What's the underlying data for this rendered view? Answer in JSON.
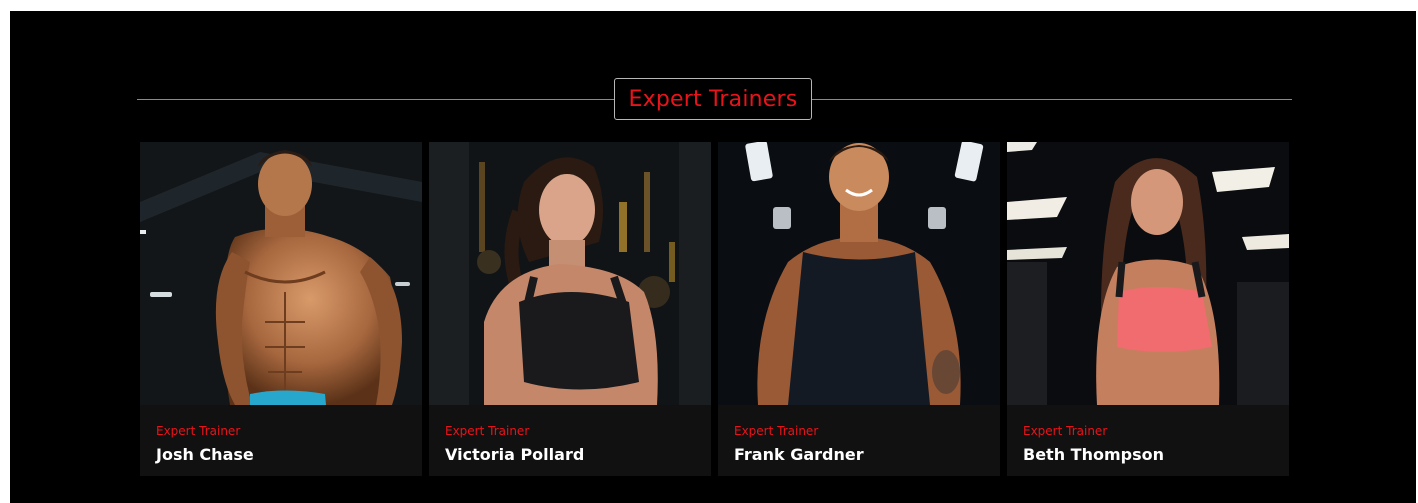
{
  "section": {
    "title": "Expert Trainers",
    "accent_color": "#e8141a"
  },
  "trainers": [
    {
      "role": "Expert Trainer",
      "name": "Josh Chase",
      "photo": "male-bodybuilder-shirtless"
    },
    {
      "role": "Expert Trainer",
      "name": "Victoria Pollard",
      "photo": "female-athlete-black-sports-bra"
    },
    {
      "role": "Expert Trainer",
      "name": "Frank Gardner",
      "photo": "male-athlete-black-tank-top"
    },
    {
      "role": "Expert Trainer",
      "name": "Beth Thompson",
      "photo": "female-athlete-pink-sports-bra"
    }
  ]
}
